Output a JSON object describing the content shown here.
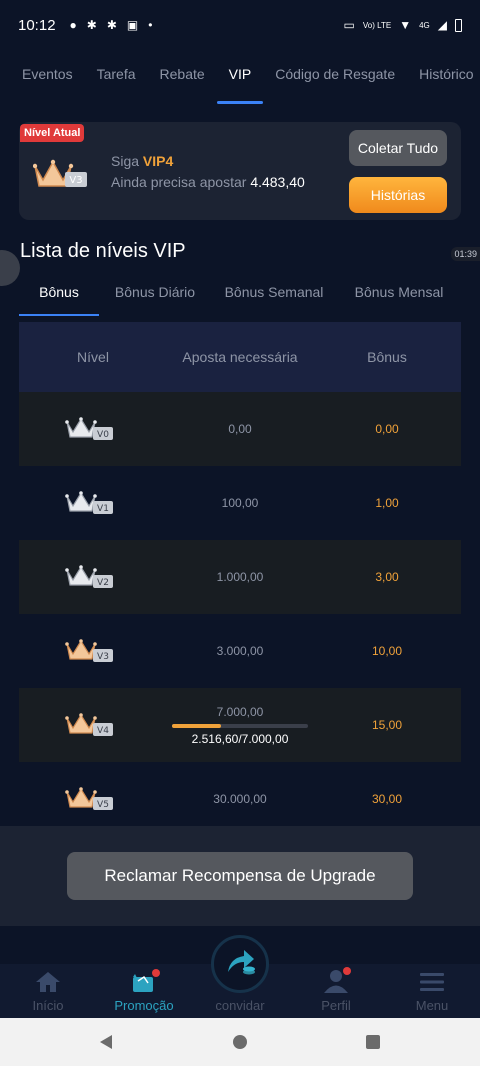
{
  "status": {
    "time": "10:12",
    "network": "4G",
    "volte": "Vo) LTE"
  },
  "tabs": [
    "Eventos",
    "Tarefa",
    "Rebate",
    "VIP",
    "Código de Resgate",
    "Histórico"
  ],
  "card": {
    "badge": "Nível Atual",
    "current_level": "V3",
    "line1_prefix": "Siga ",
    "next_vip": "VIP4",
    "line2_prefix": "Ainda precisa apostar ",
    "remaining": "4.483,40",
    "collect_label": "Coletar Tudo",
    "history_label": "Histórias"
  },
  "side_time": "01:39",
  "section_title": "Lista de níveis VIP",
  "subtabs": [
    "Bônus",
    "Bônus Diário",
    "Bônus Semanal",
    "Bônus Mensal"
  ],
  "table": {
    "headers": [
      "Nível",
      "Aposta necessária",
      "Bônus"
    ],
    "rows": [
      {
        "level": "V0",
        "bet": "0,00",
        "bonus": "0,00",
        "tier": "silver"
      },
      {
        "level": "V1",
        "bet": "100,00",
        "bonus": "1,00",
        "tier": "silver"
      },
      {
        "level": "V2",
        "bet": "1.000,00",
        "bonus": "3,00",
        "tier": "silver"
      },
      {
        "level": "V3",
        "bet": "3.000,00",
        "bonus": "10,00",
        "tier": "bronze"
      },
      {
        "level": "V4",
        "bet": "7.000,00",
        "bonus": "15,00",
        "tier": "bronze",
        "progress_text": "2.516,60/7.000,00",
        "progress": 0.36
      },
      {
        "level": "V5",
        "bet": "30.000,00",
        "bonus": "30,00",
        "tier": "bronze"
      }
    ]
  },
  "claim_label": "Reclamar Recompensa de Upgrade",
  "nav": [
    {
      "label": "Início",
      "icon": "home-icon"
    },
    {
      "label": "Promoção",
      "icon": "promo-icon"
    },
    {
      "label": "convidar",
      "icon": "invite-icon"
    },
    {
      "label": "Perfil",
      "icon": "profile-icon"
    },
    {
      "label": "Menu",
      "icon": "menu-icon"
    }
  ],
  "colors": {
    "accent": "#3b82f6",
    "gold": "#f0a23a",
    "badge_red": "#e03a3a",
    "active_nav": "#2ca3c0"
  }
}
